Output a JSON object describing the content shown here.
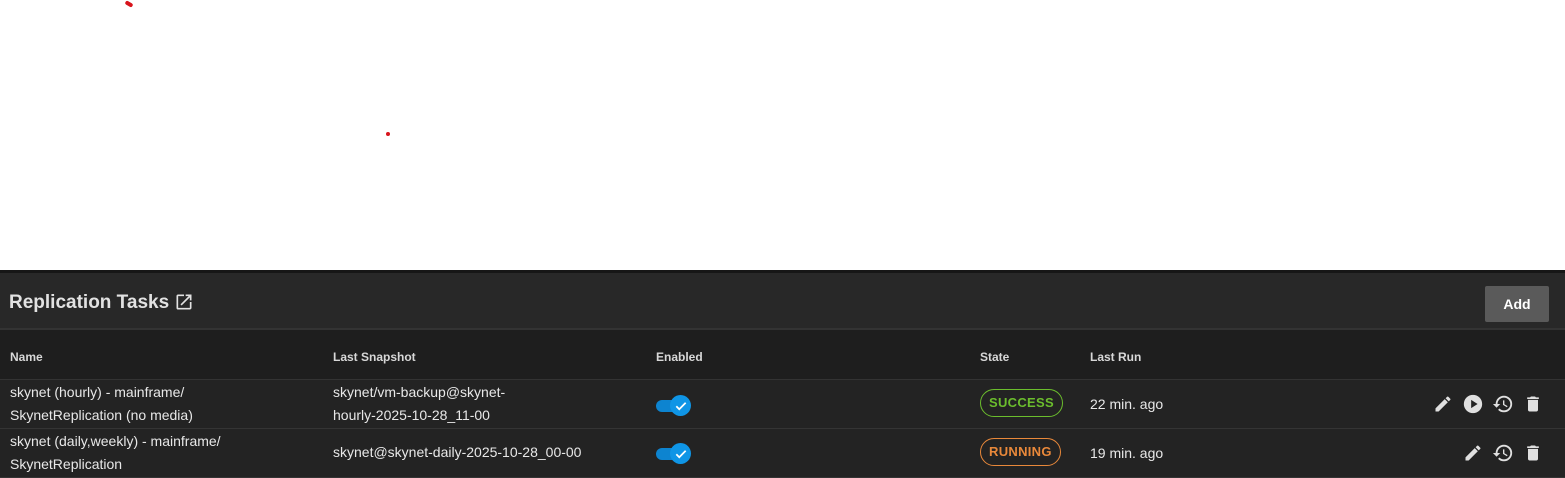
{
  "card": {
    "title": "Replication Tasks",
    "add_label": "Add",
    "icons": {
      "title_link": "open-in-new-icon",
      "edit": "pencil-icon",
      "run": "play-icon",
      "restore": "history-icon",
      "delete": "trash-icon",
      "toggle_check": "checkmark-icon"
    }
  },
  "table": {
    "columns": [
      "Name",
      "Last Snapshot",
      "Enabled",
      "State",
      "Last Run"
    ],
    "rows": [
      {
        "name_line1": "skynet (hourly) - mainframe/",
        "name_line2": "SkynetReplication (no media)",
        "snapshot_line1": "skynet/vm-backup@skynet-",
        "snapshot_line2": "hourly-2025-10-28_11-00",
        "enabled": true,
        "state": "SUCCESS",
        "last_run": "22 min. ago"
      },
      {
        "name_line1": "skynet (daily,weekly) - mainframe/",
        "name_line2": "SkynetReplication",
        "snapshot": "skynet@skynet-daily-2025-10-28_00-00",
        "enabled": true,
        "state": "RUNNING",
        "last_run": "19 min. ago"
      }
    ]
  },
  "colors": {
    "success": "#6bbd2d",
    "running": "#e8883a",
    "toggle_on": "#0f95e6",
    "card_bg": "#1e1e1e"
  }
}
